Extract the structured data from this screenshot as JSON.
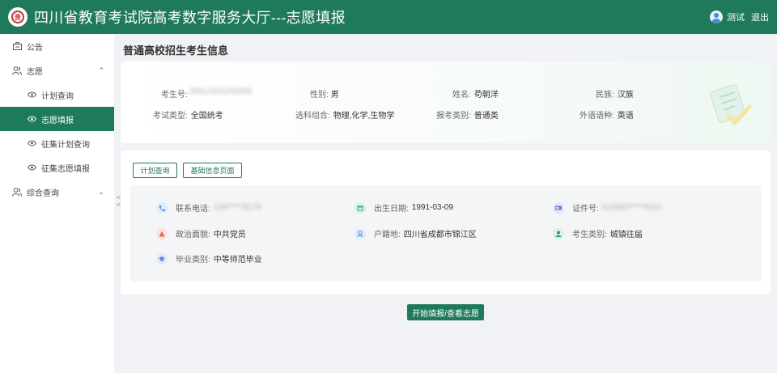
{
  "header": {
    "logo_text": "贵",
    "title": "四川省教育考试院高考数字服务大厅---志愿填报",
    "user_name": "测试",
    "logout_label": "退出"
  },
  "sidebar": {
    "items": [
      {
        "label": "公告",
        "icon": "announcement-icon"
      },
      {
        "label": "志愿",
        "icon": "users-icon",
        "expanded": true
      },
      {
        "label": "计划查询",
        "icon": "eye-icon"
      },
      {
        "label": "志愿填报",
        "icon": "eye-icon",
        "active": true
      },
      {
        "label": "征集计划查询",
        "icon": "eye-icon"
      },
      {
        "label": "征集志愿填报",
        "icon": "eye-icon"
      },
      {
        "label": "综合查询",
        "icon": "users-icon",
        "expanded": false
      }
    ],
    "collapse_glyph": "<<"
  },
  "page": {
    "title": "普通高校招生考生信息"
  },
  "basic_info": {
    "exam_no_label": "考生号:",
    "exam_no_value": "25512201150009",
    "gender_label": "性别:",
    "gender_value": "男",
    "name_label": "姓名:",
    "name_value": "苟朝洋",
    "ethnicity_label": "民族:",
    "ethnicity_value": "汉族",
    "exam_type_label": "考试类型:",
    "exam_type_value": "全国统考",
    "subject_combo_label": "选科组合:",
    "subject_combo_value": "物理,化学,生物学",
    "apply_category_label": "报考类别:",
    "apply_category_value": "普通类",
    "foreign_lang_label": "外语语种:",
    "foreign_lang_value": "英语"
  },
  "buttons": {
    "plan_query": "计划查询",
    "basic_info_page": "基础信息页面",
    "start": "开始填报/查看志愿"
  },
  "details": {
    "phone_label": "联系电话:",
    "phone_value": "134*****9179",
    "birth_label": "出生日期:",
    "birth_value": "1991-03-09",
    "id_label": "证件号:",
    "id_value": "510962*****0111",
    "political_label": "政治面貌:",
    "political_value": "中共党员",
    "hukou_label": "户籍地:",
    "hukou_value": "四川省成都市锦江区",
    "student_type_label": "考生类别:",
    "student_type_value": "城镇往届",
    "graduation_label": "毕业类别:",
    "graduation_value": "中等师范毕业"
  },
  "colors": {
    "brand": "#1f7a5c",
    "phone_icon": "#4a8bd6",
    "birth_icon": "#3aa57a",
    "id_icon": "#6b7fd6",
    "political_icon": "#e06a4a",
    "hukou_icon": "#4a8bd6",
    "student_type_icon": "#2f9e74",
    "graduation_icon": "#6b7fd6"
  }
}
